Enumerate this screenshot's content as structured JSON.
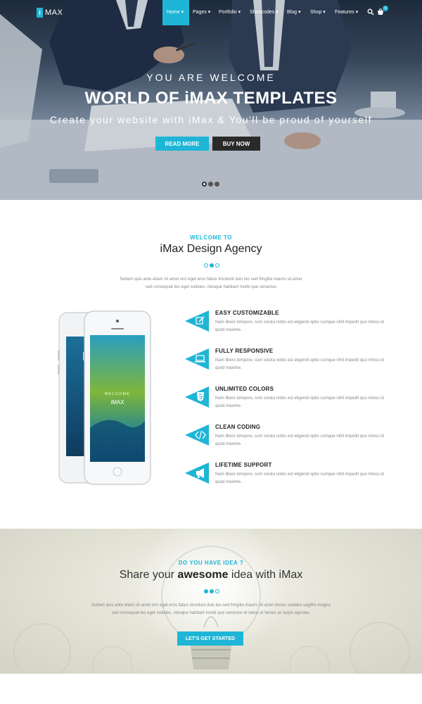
{
  "nav": {
    "logo_badge": "i",
    "logo_text": "MAX",
    "items": [
      "Home ▾",
      "Pages ▾",
      "Portfolio ▾",
      "Shortcodes ▾",
      "Blog ▾",
      "Shop ▾",
      "Features ▾"
    ],
    "active_index": 0,
    "cart_count": "0",
    "search_icon": "search-icon",
    "cart_icon": "cart-icon"
  },
  "hero": {
    "welcome": "YOU ARE WELCOME",
    "title": "WORLD OF iMAX TEMPLATES",
    "subtitle": "Create your website with iMax & You'll be proud of yourself",
    "read_more": "READ MORE",
    "buy_now": "BUY NOW",
    "slide_count": 3,
    "active_slide": 0
  },
  "welcome": {
    "eyebrow": "WELCOME TO",
    "title": "iMax Design Agency",
    "text_line1": "Nullam quis ante etiam sit amet orci eget eros fabus tincidunt duis leo sed fringilla mauris sit amet",
    "text_line2": "sed consequat leo eget sodales, ntesque habitant morbi que senectus"
  },
  "phone": {
    "screen_welcome": "WELCOME",
    "screen_logo": "iMAX"
  },
  "features": [
    {
      "title": "EASY CUSTOMIZABLE",
      "line1": "Nam libero tempore, cum soluta nobis est eligendi optio cumque nihil impedit quo minus id",
      "line2": "quod maxime.",
      "icon": "edit-icon"
    },
    {
      "title": "FULLY RESPONSIVE",
      "line1": "Nam libero tempore, cum soluta nobis est eligendi optio cumque nihil impedit quo minus id",
      "line2": "quod maxime.",
      "icon": "laptop-icon"
    },
    {
      "title": "UNLIMITED COLORS",
      "line1": "Nam libero tempore, cum soluta nobis est eligendi optio cumque nihil impedit quo minus id",
      "line2": "quod maxime.",
      "icon": "html5-icon"
    },
    {
      "title": "CLEAN CODING",
      "line1": "Nam libero tempore, cum soluta nobis est eligendi optio cumque nihil impedit quo minus id",
      "line2": "quod maxime.",
      "icon": "code-icon"
    },
    {
      "title": "LIFETIME SUPPORT",
      "line1": "Nam libero tempore, cum soluta nobis est eligendi optio cumque nihil impedit quo minus id",
      "line2": "quod maxime.",
      "icon": "megaphone-icon"
    }
  ],
  "idea": {
    "eyebrow": "DO YOU HAVE IDEA ?",
    "title_pre": "Share your ",
    "title_bold": "awesome",
    "title_post": " idea with iMax",
    "text_line1": "Nullam quis ante etiam sit amet orci eget eros fabus tincidunt duis leo sed fringilla mauris sit amet donec sodales sagittis magna",
    "text_line2": "sed consequat leo eget sodales, ntesque habitant morbi que senectus et netus et fames ac turpis egestas.",
    "cta": "LET'S GET STARTED"
  },
  "colors": {
    "accent": "#1fb5d6",
    "dark_button": "#2a2a2a"
  }
}
